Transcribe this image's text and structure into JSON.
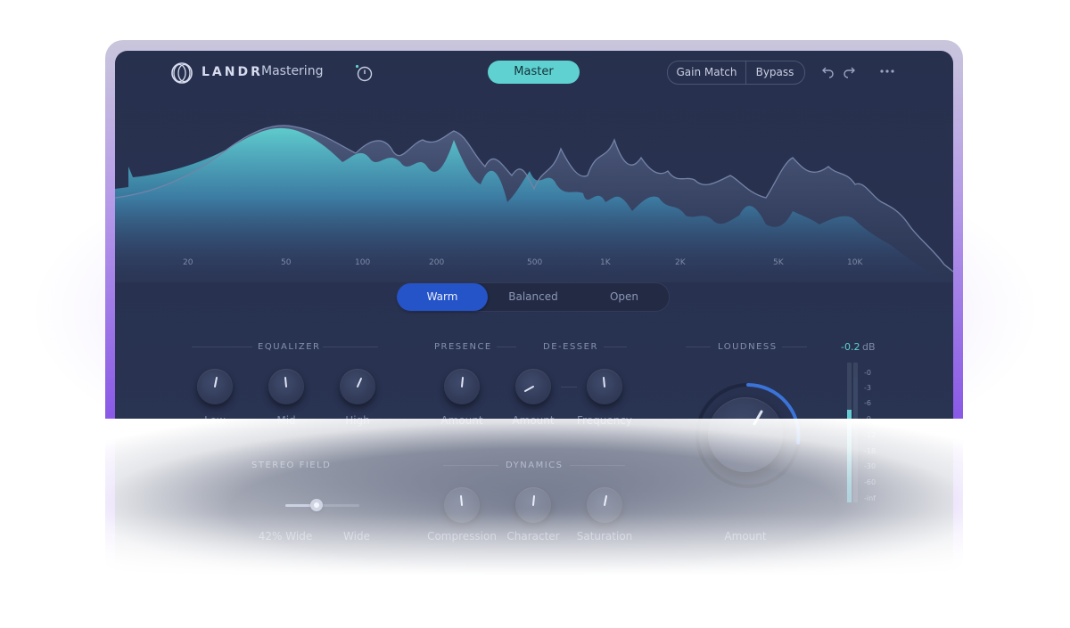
{
  "header": {
    "brand": "LANDR",
    "product": "Mastering",
    "master_label": "Master",
    "gain_match_label": "Gain Match",
    "bypass_label": "Bypass"
  },
  "spectrum": {
    "freq_labels": [
      "20",
      "50",
      "100",
      "200",
      "500",
      "1K",
      "2K",
      "5K",
      "10K"
    ]
  },
  "tone": {
    "options": [
      "Warm",
      "Balanced",
      "Open"
    ],
    "selected": "Warm"
  },
  "sections": {
    "equalizer": "EQUALIZER",
    "presence": "PRESENCE",
    "de_esser": "DE-ESSER",
    "loudness": "LOUDNESS",
    "stereo_field": "STEREO FIELD",
    "dynamics": "DYNAMICS"
  },
  "knobs": {
    "eq_low": "Low",
    "eq_mid": "Mid",
    "eq_high": "High",
    "presence_amount": "Amount",
    "deesser_amount": "Amount",
    "deesser_frequency": "Frequency",
    "compression": "Compression",
    "character": "Character",
    "saturation": "Saturation",
    "loudness_amount": "Amount"
  },
  "stereo": {
    "value_label": "42% Wide",
    "mode_label": "Wide",
    "value_fraction": 0.42
  },
  "meter": {
    "value": "-0.2",
    "unit": "dB",
    "scale": [
      "-0",
      "-3",
      "-6",
      "-9",
      "-12",
      "-18",
      "-30",
      "-60",
      "-inf"
    ]
  },
  "colors": {
    "accent": "#5fd1d0",
    "selected_tone": "#2553c8",
    "panel": "#283250",
    "frame": "#8a5ae6"
  },
  "icons": {
    "logo": "landr-logo-icon",
    "reference": "reference-timer-icon",
    "undo": "undo-icon",
    "redo": "redo-icon",
    "more": "more-dots-icon"
  }
}
